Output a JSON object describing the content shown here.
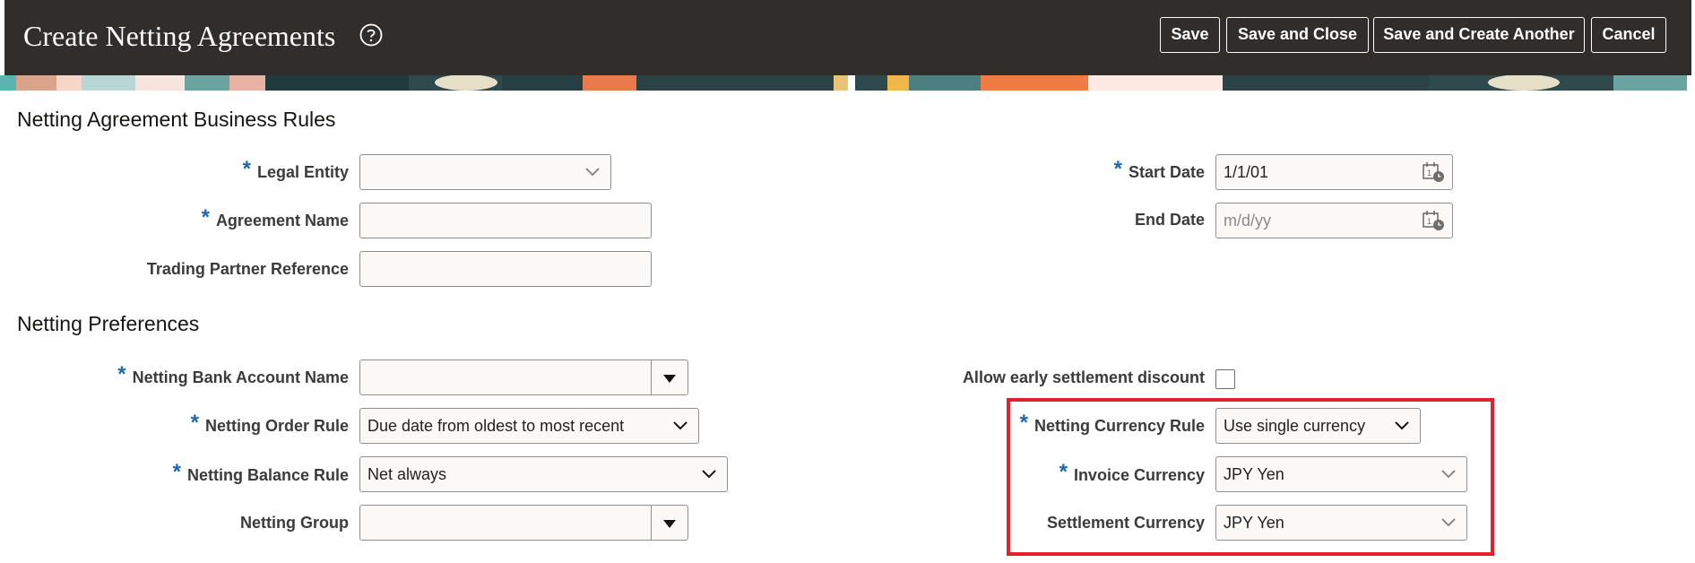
{
  "header": {
    "title": "Create Netting Agreements",
    "buttons": {
      "save": "Save",
      "save_and_close": "Save and Close",
      "save_and_create_another": "Save and Create Another",
      "cancel": "Cancel"
    }
  },
  "sections": {
    "business_rules": "Netting Agreement Business Rules",
    "preferences": "Netting Preferences"
  },
  "business_rules": {
    "legal_entity": {
      "label": "Legal Entity",
      "required": "*",
      "value": ""
    },
    "agreement_name": {
      "label": "Agreement Name",
      "required": "*",
      "value": ""
    },
    "trading_partner_reference": {
      "label": "Trading Partner Reference",
      "value": ""
    },
    "start_date": {
      "label": "Start Date",
      "required": "*",
      "value": "1/1/01"
    },
    "end_date": {
      "label": "End Date",
      "placeholder": "m/d/yy",
      "value": ""
    }
  },
  "preferences": {
    "netting_bank_account_name": {
      "label": "Netting Bank Account Name",
      "required": "*",
      "value": ""
    },
    "netting_order_rule": {
      "label": "Netting Order Rule",
      "required": "*",
      "value": "Due date from oldest to most recent"
    },
    "netting_balance_rule": {
      "label": "Netting Balance Rule",
      "required": "*",
      "value": "Net always"
    },
    "netting_group": {
      "label": "Netting Group",
      "value": ""
    },
    "allow_early_settlement_discount": {
      "label": "Allow early settlement discount",
      "checked": false
    },
    "netting_currency_rule": {
      "label": "Netting Currency Rule",
      "required": "*",
      "value": "Use single currency"
    },
    "invoice_currency": {
      "label": "Invoice Currency",
      "required": "*",
      "value": "JPY Yen"
    },
    "settlement_currency": {
      "label": "Settlement Currency",
      "value": "JPY Yen"
    }
  },
  "icons": {
    "help": "help-circle-icon",
    "calendar": "calendar-icon",
    "chevron": "chevron-down-icon",
    "dropdown": "triangle-down-icon"
  },
  "colors": {
    "header_bg": "#312d2a",
    "required_asterisk": "#1f66b0",
    "highlight_box": "#e4202a"
  }
}
